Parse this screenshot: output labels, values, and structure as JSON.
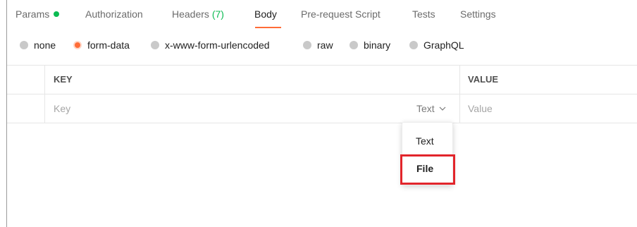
{
  "tabs": [
    {
      "label": "Params"
    },
    {
      "label": "Authorization"
    },
    {
      "label": "Headers",
      "count": "(7)"
    },
    {
      "label": "Body"
    },
    {
      "label": "Pre-request Script"
    },
    {
      "label": "Tests"
    },
    {
      "label": "Settings"
    }
  ],
  "active_tab": "Body",
  "body_types": [
    "none",
    "form-data",
    "x-www-form-urlencoded",
    "raw",
    "binary",
    "GraphQL"
  ],
  "selected_body_type": "form-data",
  "table": {
    "columns": [
      "KEY",
      "VALUE"
    ],
    "row": {
      "key_placeholder": "Key",
      "type": "Text",
      "value_placeholder": "Value"
    }
  },
  "type_dropdown": {
    "options": [
      "Text",
      "File"
    ],
    "highlighted": "File"
  },
  "colors": {
    "accent": "#ff6c37",
    "indicator_green": "#0cbb52",
    "highlight_box": "#e2252b"
  }
}
